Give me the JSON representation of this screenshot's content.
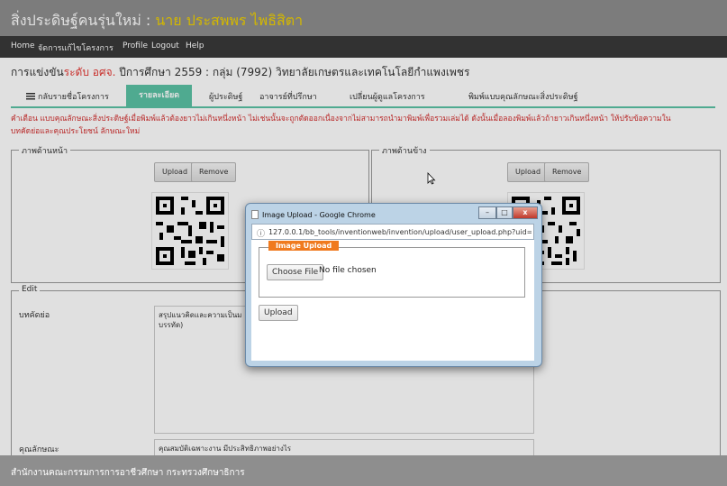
{
  "header": {
    "title_prefix": "สิ่งประดิษฐ์คนรุ่นใหม่ : ",
    "title_name": "นาย ประสพพร ไพธิสิตา"
  },
  "nav": {
    "items": [
      "Home",
      "จัดการแก้ไขโครงการ",
      "Profile",
      "Logout",
      "Help"
    ]
  },
  "contest": {
    "prefix": "การแข่งขัน",
    "level": "ระดับ อศจ.",
    "rest": " ปีการศึกษา 2559 : กลุ่ม (7992) วิทยาลัยเกษตรและเทคโนโลยีกำแพงเพชร"
  },
  "tabs": [
    {
      "label": "กลับรายชื่อโครงการ",
      "icon": "list-icon"
    },
    {
      "label": "รายละเอียด",
      "active": true
    },
    {
      "label": "ผู้ประดิษฐ์"
    },
    {
      "label": "อาจารย์ที่ปรึกษา"
    },
    {
      "label": "เปลี่ยนผู้ดูแลโครงการ"
    },
    {
      "label": "พิมพ์แบบคุณลักษณะสิ่งประดิษฐ์"
    }
  ],
  "warning": {
    "line1": "คำเตือน แบบคุณลักษณะสิ่งประดิษฐ์เมื่อพิมพ์แล้วต้องยาวไม่เกินหนึ่งหน้า ไม่เช่นนั้นจะถูกตัดออกเนื่องจากไม่สามารถนำมาพิมพ์เพื่อรวมเล่มได้ ดังนั้นเมื่อลองพิมพ์แล้วถ้ายาวเกินหนึ่งหน้า ให้ปรับข้อความใน",
    "line2": "บทคัดย่อและคุณประโยชน์ ลักษณะใหม่"
  },
  "front_image": {
    "legend": "ภาพด้านหน้า",
    "upload": "Upload",
    "remove": "Remove"
  },
  "side_image": {
    "legend": "ภาพด้านข้าง",
    "upload": "Upload",
    "remove": "Remove"
  },
  "edit": {
    "legend": "Edit",
    "abstract_label": "บทคัดย่อ",
    "abstract_value": "สรุปแนวคิดและความเป็นม\nบรรทัด)",
    "feature_label": "คุณลักษณะ",
    "feature_value": "คุณสมบัติเฉพาะงาน มีประสิทธิภาพอย่างไร"
  },
  "footer": {
    "text": "สำนักงานคณะกรรมการการอาชีวศึกษา กระทรวงศึกษาธิการ"
  },
  "popup": {
    "title": "Image Upload - Google Chrome",
    "url": "127.0.0.1/bb_tools/inventionweb/invention/upload/user_upload.php?uid=",
    "legend": "Image Upload",
    "choose_file": "Choose File",
    "no_file": "No file chosen",
    "upload": "Upload",
    "controls": [
      "–",
      "□",
      "x"
    ]
  },
  "colors": {
    "header": "#8e8e8e",
    "navbar": "#3a3a3a",
    "tab_active": "#5ac2a4",
    "title_name": "#f1d100",
    "warning": "#d32f2f",
    "popup_legend": "#f07a1e"
  }
}
